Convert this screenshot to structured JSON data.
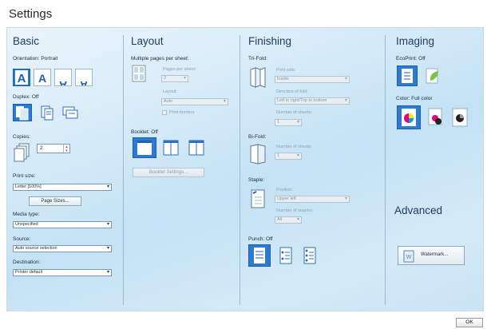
{
  "window": {
    "title": "Settings"
  },
  "basic": {
    "heading": "Basic",
    "orientation_label": "Orientation: Portrait",
    "duplex_label": "Duplex: Off",
    "copies_label": "Copies:",
    "copies_value": "2",
    "print_size_label": "Print size:",
    "print_size_value": "Letter [100%]",
    "page_sizes_button": "Page Sizes...",
    "media_type_label": "Media type:",
    "media_type_value": "Unspecified",
    "source_label": "Source:",
    "source_value": "Auto source selection",
    "destination_label": "Destination:",
    "destination_value": "Printer default"
  },
  "layout": {
    "heading": "Layout",
    "multipage_label": "Multiple pages per sheet:",
    "pages_per_sheet_label": "Pages per sheet:",
    "pages_per_sheet_value": "2",
    "layout_label": "Layout:",
    "layout_value": "Auto",
    "print_borders_label": "Print borders",
    "booklet_label": "Booklet: Off",
    "booklet_settings_button": "Booklet Settings..."
  },
  "finishing": {
    "heading": "Finishing",
    "trifold_label": "Tri-Fold:",
    "print_side_label": "Print side:",
    "print_side_value": "Inside",
    "direction_label": "Direction of fold:",
    "direction_value": "Left to right/Top to bottom",
    "trifold_sheets_label": "Number of sheets:",
    "trifold_sheets_value": "1",
    "bifold_label": "Bi-Fold:",
    "bifold_sheets_label": "Number of sheets:",
    "bifold_sheets_value": "1",
    "staple_label": "Staple:",
    "position_label": "Position:",
    "position_value": "Upper left",
    "staple_count_label": "Number of staples:",
    "staple_count_value": "All",
    "punch_label": "Punch: Off"
  },
  "imaging": {
    "heading": "Imaging",
    "ecoprint_label": "EcoPrint: Off",
    "color_label": "Color: Full color"
  },
  "advanced": {
    "heading": "Advanced",
    "watermark_button": "Watermark..."
  },
  "footer": {
    "ok_button": "OK"
  }
}
